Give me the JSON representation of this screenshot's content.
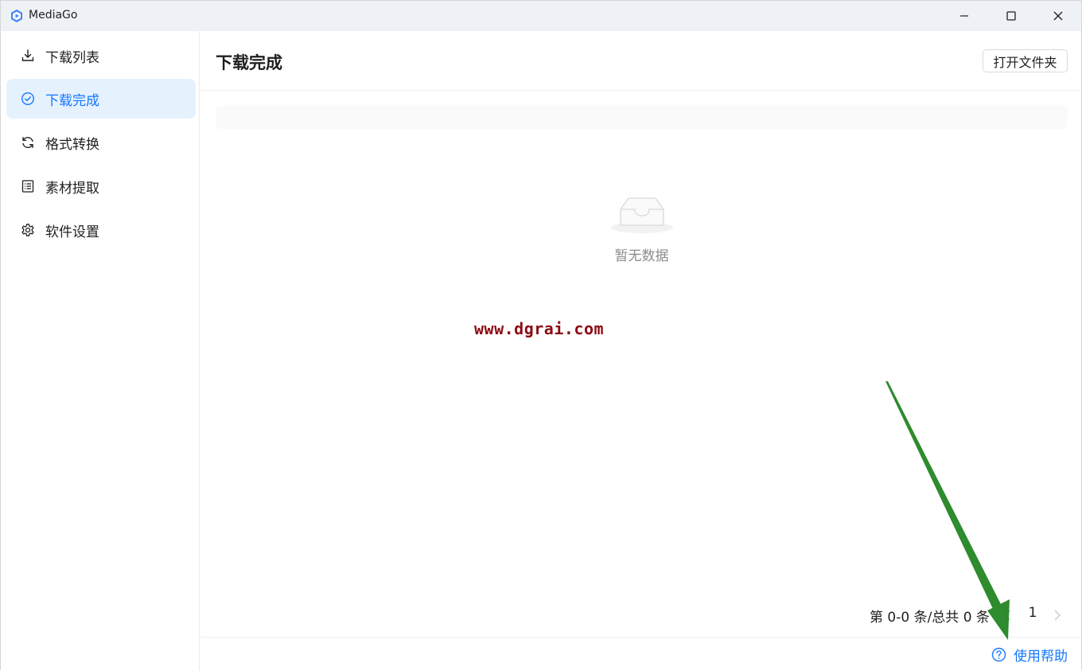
{
  "window": {
    "title": "MediaGo",
    "minimize_icon": "minimize-icon",
    "maximize_icon": "maximize-icon",
    "close_icon": "close-icon"
  },
  "sidebar": {
    "items": [
      {
        "label": "下载列表",
        "icon": "download-icon",
        "active": false
      },
      {
        "label": "下载完成",
        "icon": "check-circle-icon",
        "active": true
      },
      {
        "label": "格式转换",
        "icon": "refresh-icon",
        "active": false
      },
      {
        "label": "素材提取",
        "icon": "list-icon",
        "active": false
      },
      {
        "label": "软件设置",
        "icon": "gear-icon",
        "active": false
      }
    ]
  },
  "main": {
    "title": "下载完成",
    "open_folder_label": "打开文件夹",
    "empty_text": "暂无数据",
    "watermark": "www.dgrai.com"
  },
  "pagination": {
    "total_text": "第 0-0 条/总共 0 条",
    "current_page": "1"
  },
  "footer": {
    "help_label": "使用帮助",
    "help_icon": "question-circle-icon"
  },
  "colors": {
    "accent": "#1677ff",
    "active_bg": "#e6f1fe",
    "watermark": "#8b0a14",
    "arrow": "#2e8b2e"
  }
}
